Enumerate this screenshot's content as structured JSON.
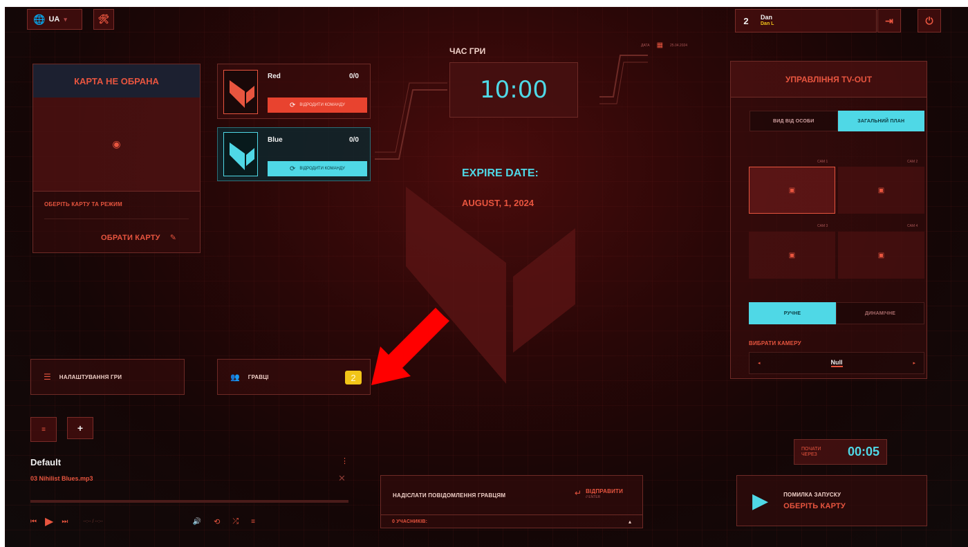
{
  "topbar": {
    "language": "UA",
    "player_count": "2",
    "user_name": "Dan",
    "user_sub": "Dan L"
  },
  "map_panel": {
    "title": "КАРТА НЕ ОБРАНА",
    "hint": "ОБЕРІТЬ КАРТУ ТА РЕЖИМ",
    "select_label": "ОБРАТИ КАРТУ"
  },
  "teams": [
    {
      "name": "Red",
      "score": "0/0",
      "revive_label": "ВІДРОДИТИ КОМАНДУ"
    },
    {
      "name": "Blue",
      "score": "0/0",
      "revive_label": "ВІДРОДИТИ КОМАНДУ"
    }
  ],
  "game_time": {
    "label": "ЧАС ГРИ",
    "value": "10:00",
    "date_label": "ДАТА",
    "date_value": "25.04.2024"
  },
  "expire": {
    "label": "EXPIRE DATE:",
    "date": "AUGUST, 1, 2024"
  },
  "tvout": {
    "title": "УПРАВЛІННЯ TV-OUT",
    "tabs": [
      "ВИД ВІД ОСОБИ",
      "ЗАГАЛЬНИЙ ПЛАН"
    ],
    "cams": [
      "CAM 1",
      "CAM 2",
      "CAM 3",
      "CAM 4"
    ],
    "modes": [
      "РУЧНЕ",
      "ДИНАМІЧНЕ"
    ],
    "select_label": "ВИБРАТИ КАМЕРУ",
    "selected_camera": "Null"
  },
  "settings_button": {
    "label": "НАЛАШТУВАННЯ ГРИ"
  },
  "players_button": {
    "label": "ГРАВЦІ",
    "count": "2"
  },
  "music": {
    "playlist": "Default",
    "track": "03 Nihilist Blues.mp3",
    "time": "--:-- / --:--"
  },
  "message": {
    "placeholder": "НАДІСЛАТИ ПОВІДОМЛЕННЯ ГРАВЦЯМ",
    "send_label": "ВІДПРАВИТИ",
    "send_hint": "// ENTER",
    "participants": "0 УЧАСНИКІВ:"
  },
  "start": {
    "countdown_label": "ПОЧАТИ ЧЕРЕЗ",
    "countdown": "00:05",
    "error_title": "ПОМИЛКА ЗАПУСКУ",
    "error_hint": "ОБЕРІТЬ КАРТУ"
  },
  "colors": {
    "accent_red": "#e8553f",
    "accent_cyan": "#4fd8e6",
    "badge_yellow": "#f2c518",
    "annotation_arrow": "#ff0000"
  }
}
